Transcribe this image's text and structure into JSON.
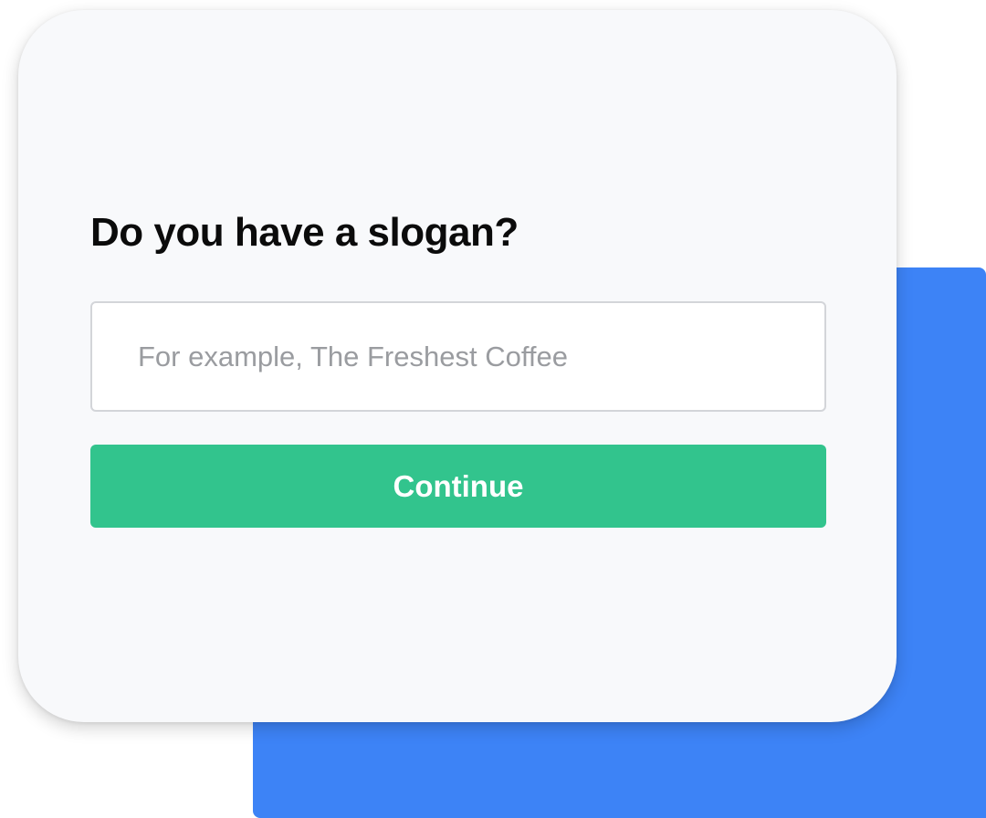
{
  "form": {
    "question": "Do you have a slogan?",
    "slogan_value": "",
    "slogan_placeholder": "For example, The Freshest Coffee",
    "continue_label": "Continue"
  },
  "colors": {
    "backdrop": "#3d83f6",
    "card": "#f8f9fb",
    "accent": "#32c48d",
    "input_border": "#d3d5d9",
    "placeholder": "#9a9ca0",
    "heading": "#0b0b0b"
  }
}
